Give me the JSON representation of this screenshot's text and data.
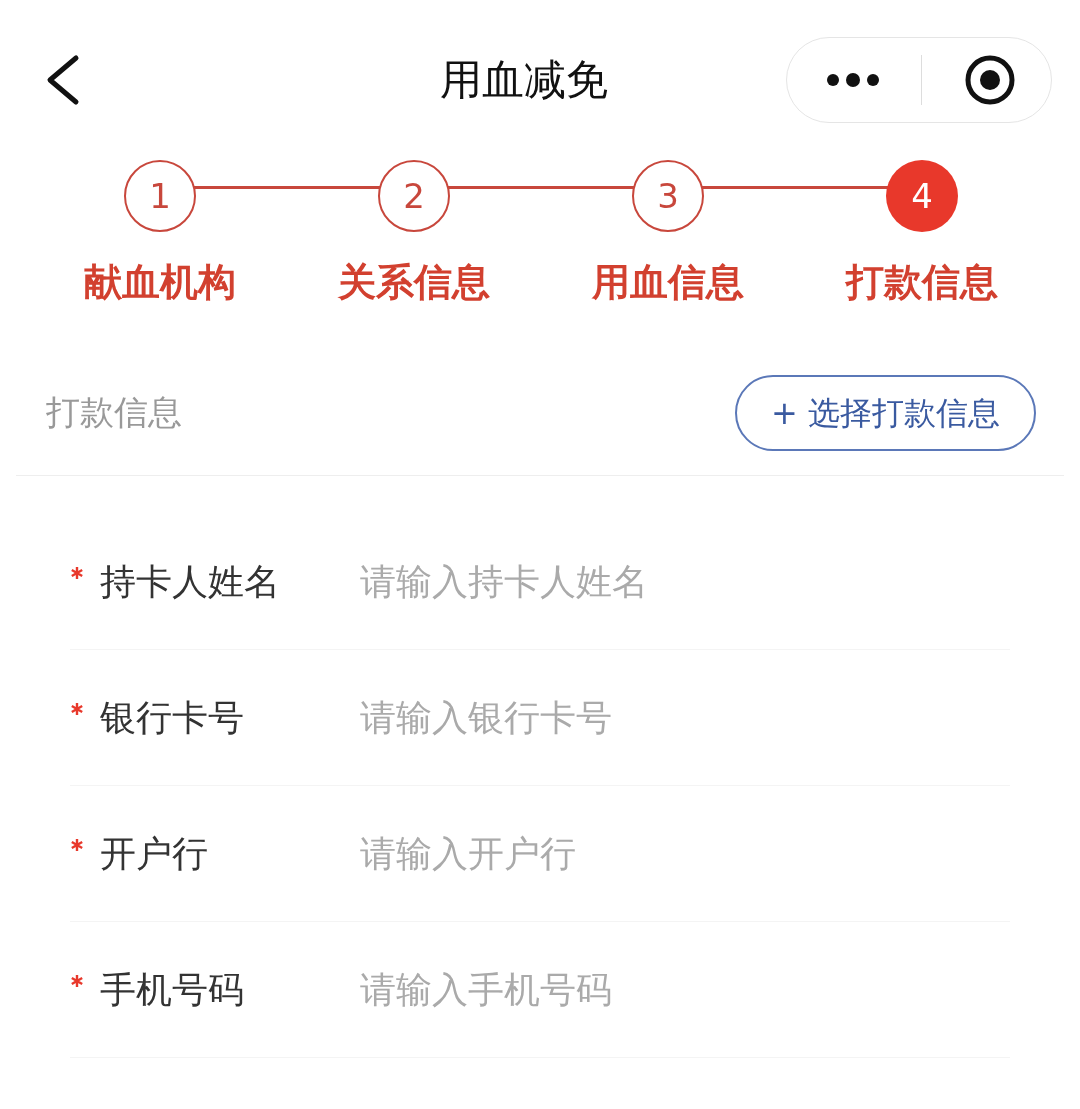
{
  "title": "用血减免",
  "steps": [
    {
      "number": "1",
      "label": "献血机构",
      "selected": false
    },
    {
      "number": "2",
      "label": "关系信息",
      "selected": false
    },
    {
      "number": "3",
      "label": "用血信息",
      "selected": false
    },
    {
      "number": "4",
      "label": "打款信息",
      "selected": true
    }
  ],
  "section": {
    "title": "打款信息",
    "button": "+ 选择打款信息"
  },
  "fields": [
    {
      "label": "持卡人姓名",
      "required": true,
      "placeholder": "请输入持卡人姓名"
    },
    {
      "label": "银行卡号",
      "required": true,
      "placeholder": "请输入银行卡号"
    },
    {
      "label": "开户行",
      "required": true,
      "placeholder": "请输入开户行"
    },
    {
      "label": "手机号码",
      "required": true,
      "placeholder": "请输入手机号码"
    }
  ]
}
